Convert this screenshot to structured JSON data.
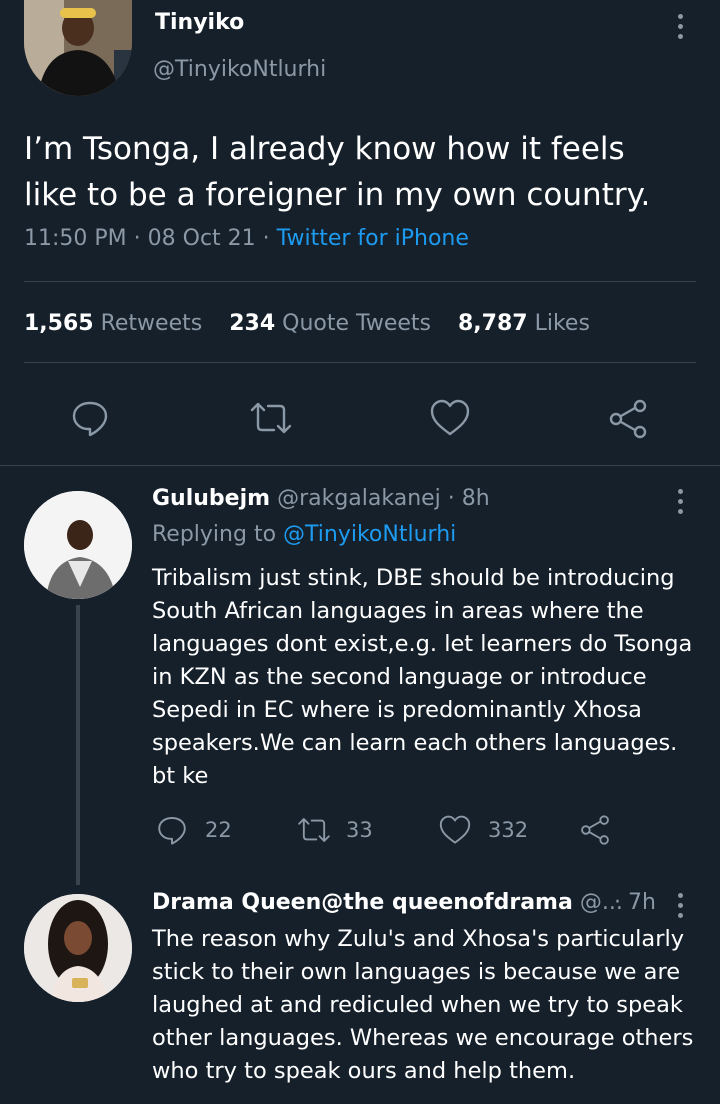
{
  "main_tweet": {
    "author_name": "Tinyiko",
    "author_handle": "@TinyikoNtlurhi",
    "text_line1": "I’m Tsonga, I already know how it feels",
    "text_line2": "like to be a foreigner in my own country.",
    "time": "11:50 PM",
    "sep1": "·",
    "date": "08 Oct 21",
    "sep2": "·",
    "source": "Twitter for iPhone",
    "stats": {
      "retweets_count": "1,565",
      "retweets_label": "Retweets",
      "quotes_count": "234",
      "quotes_label": "Quote Tweets",
      "likes_count": "8,787",
      "likes_label": "Likes"
    }
  },
  "replies": [
    {
      "author_name": "Gulubejm",
      "author_handle": "@rakgalakanej",
      "time": "· 8h",
      "replying_prefix": "Replying to",
      "replying_handle": "@TinyikoNtlurhi",
      "lines": [
        "Tribalism just stink, DBE should be introducing",
        "South African languages in areas where the",
        "languages dont exist,e.g. let learners do Tsonga",
        "in KZN as the second language or introduce",
        "Sepedi in EC where is predominantly Xhosa",
        "speakers.We can learn each others languages.",
        "bt ke"
      ],
      "reply_count": "22",
      "retweet_count": "33",
      "like_count": "332"
    },
    {
      "author_name": "Drama Queen@the queenofdrama",
      "author_handle": "@...",
      "time": "· 7h",
      "lines": [
        "The reason why Zulu's and Xhosa's particularly",
        "stick to their own languages is because we are",
        "laughed at and rediculed when we try to speak",
        "other languages. Whereas we encourage others",
        "who try to speak ours and help them."
      ]
    }
  ],
  "colors": {
    "background": "#15202b",
    "muted": "#8b98a5",
    "link": "#1d9bf0",
    "divider": "#38444d"
  }
}
